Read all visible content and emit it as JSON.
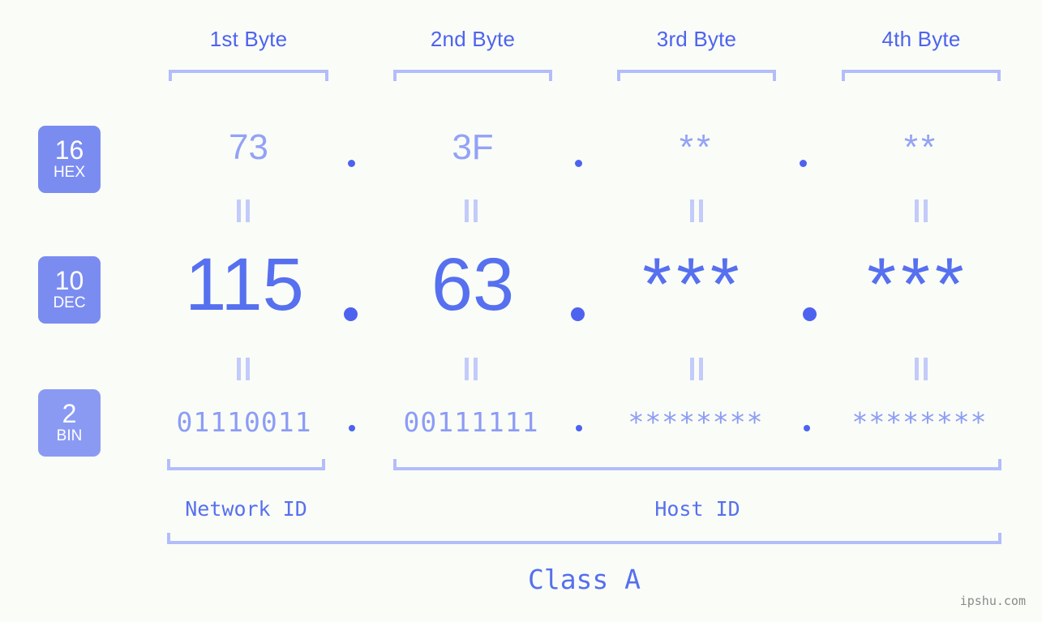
{
  "meta": {
    "watermark": "ipshu.com",
    "background_color": "#fafdf7",
    "accent_color": "#5670ef",
    "accent_light_color": "#b3bdfb",
    "badge_color": "#7b8cf0"
  },
  "headers": {
    "byte1": "1st Byte",
    "byte2": "2nd Byte",
    "byte3": "3rd Byte",
    "byte4": "4th Byte"
  },
  "bases": {
    "hex": {
      "number": "16",
      "label": "HEX"
    },
    "dec": {
      "number": "10",
      "label": "DEC"
    },
    "bin": {
      "number": "2",
      "label": "BIN"
    }
  },
  "rows": {
    "hex": {
      "values": [
        "73",
        "3F",
        "**",
        "**"
      ],
      "separators": [
        ".",
        ".",
        "."
      ]
    },
    "dec": {
      "values": [
        "115",
        "63",
        "***",
        "***"
      ],
      "separators": [
        ".",
        ".",
        "."
      ]
    },
    "bin": {
      "values": [
        "01110011",
        "00111111",
        "********",
        "********"
      ],
      "separators": [
        ".",
        ".",
        "."
      ]
    }
  },
  "connectors": {
    "symbol": "||"
  },
  "footer": {
    "network_id": "Network ID",
    "host_id": "Host ID",
    "class": "Class A"
  },
  "chart_data": {
    "type": "table",
    "title": "IPv4 address byte breakdown - Class A",
    "columns": [
      "Base",
      "1st Byte",
      "2nd Byte",
      "3rd Byte",
      "4th Byte"
    ],
    "rows": [
      [
        "16 HEX",
        "73",
        "3F",
        "**",
        "**"
      ],
      [
        "10 DEC",
        "115",
        "63",
        "***",
        "***"
      ],
      [
        "2 BIN",
        "01110011",
        "00111111",
        "********",
        "********"
      ]
    ],
    "annotations": {
      "network_id_bytes": [
        1
      ],
      "host_id_bytes": [
        2,
        3,
        4
      ],
      "address_class": "Class A"
    }
  }
}
